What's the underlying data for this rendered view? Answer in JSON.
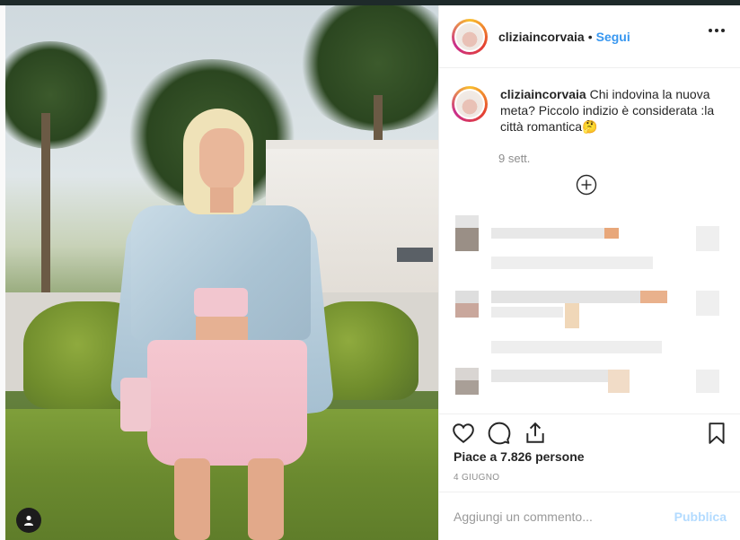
{
  "post": {
    "username": "cliziaincorvaia",
    "follow_label": "Segui",
    "dot": "•",
    "caption_username": "cliziaincorvaia",
    "caption_text": " Chi indovina la nuova meta? Piccolo indizio è considerata :la città romantica🤔",
    "caption_date": "9 sett.",
    "likes_text": "Piace a 7.826 persone",
    "timestamp": "4 GIUGNO"
  },
  "comment_bar": {
    "placeholder": "Aggiungi un commento...",
    "publish_label": "Pubblica"
  },
  "icons": {
    "more": "more-options-icon",
    "like": "heart-icon",
    "comment": "comment-icon",
    "share": "share-icon",
    "save": "bookmark-icon",
    "load_more": "plus-circle-icon",
    "tag": "user-tag-icon"
  },
  "colors": {
    "accent": "#3897f0",
    "publish_disabled": "#b3dbff",
    "muted": "#8e8e8e"
  }
}
